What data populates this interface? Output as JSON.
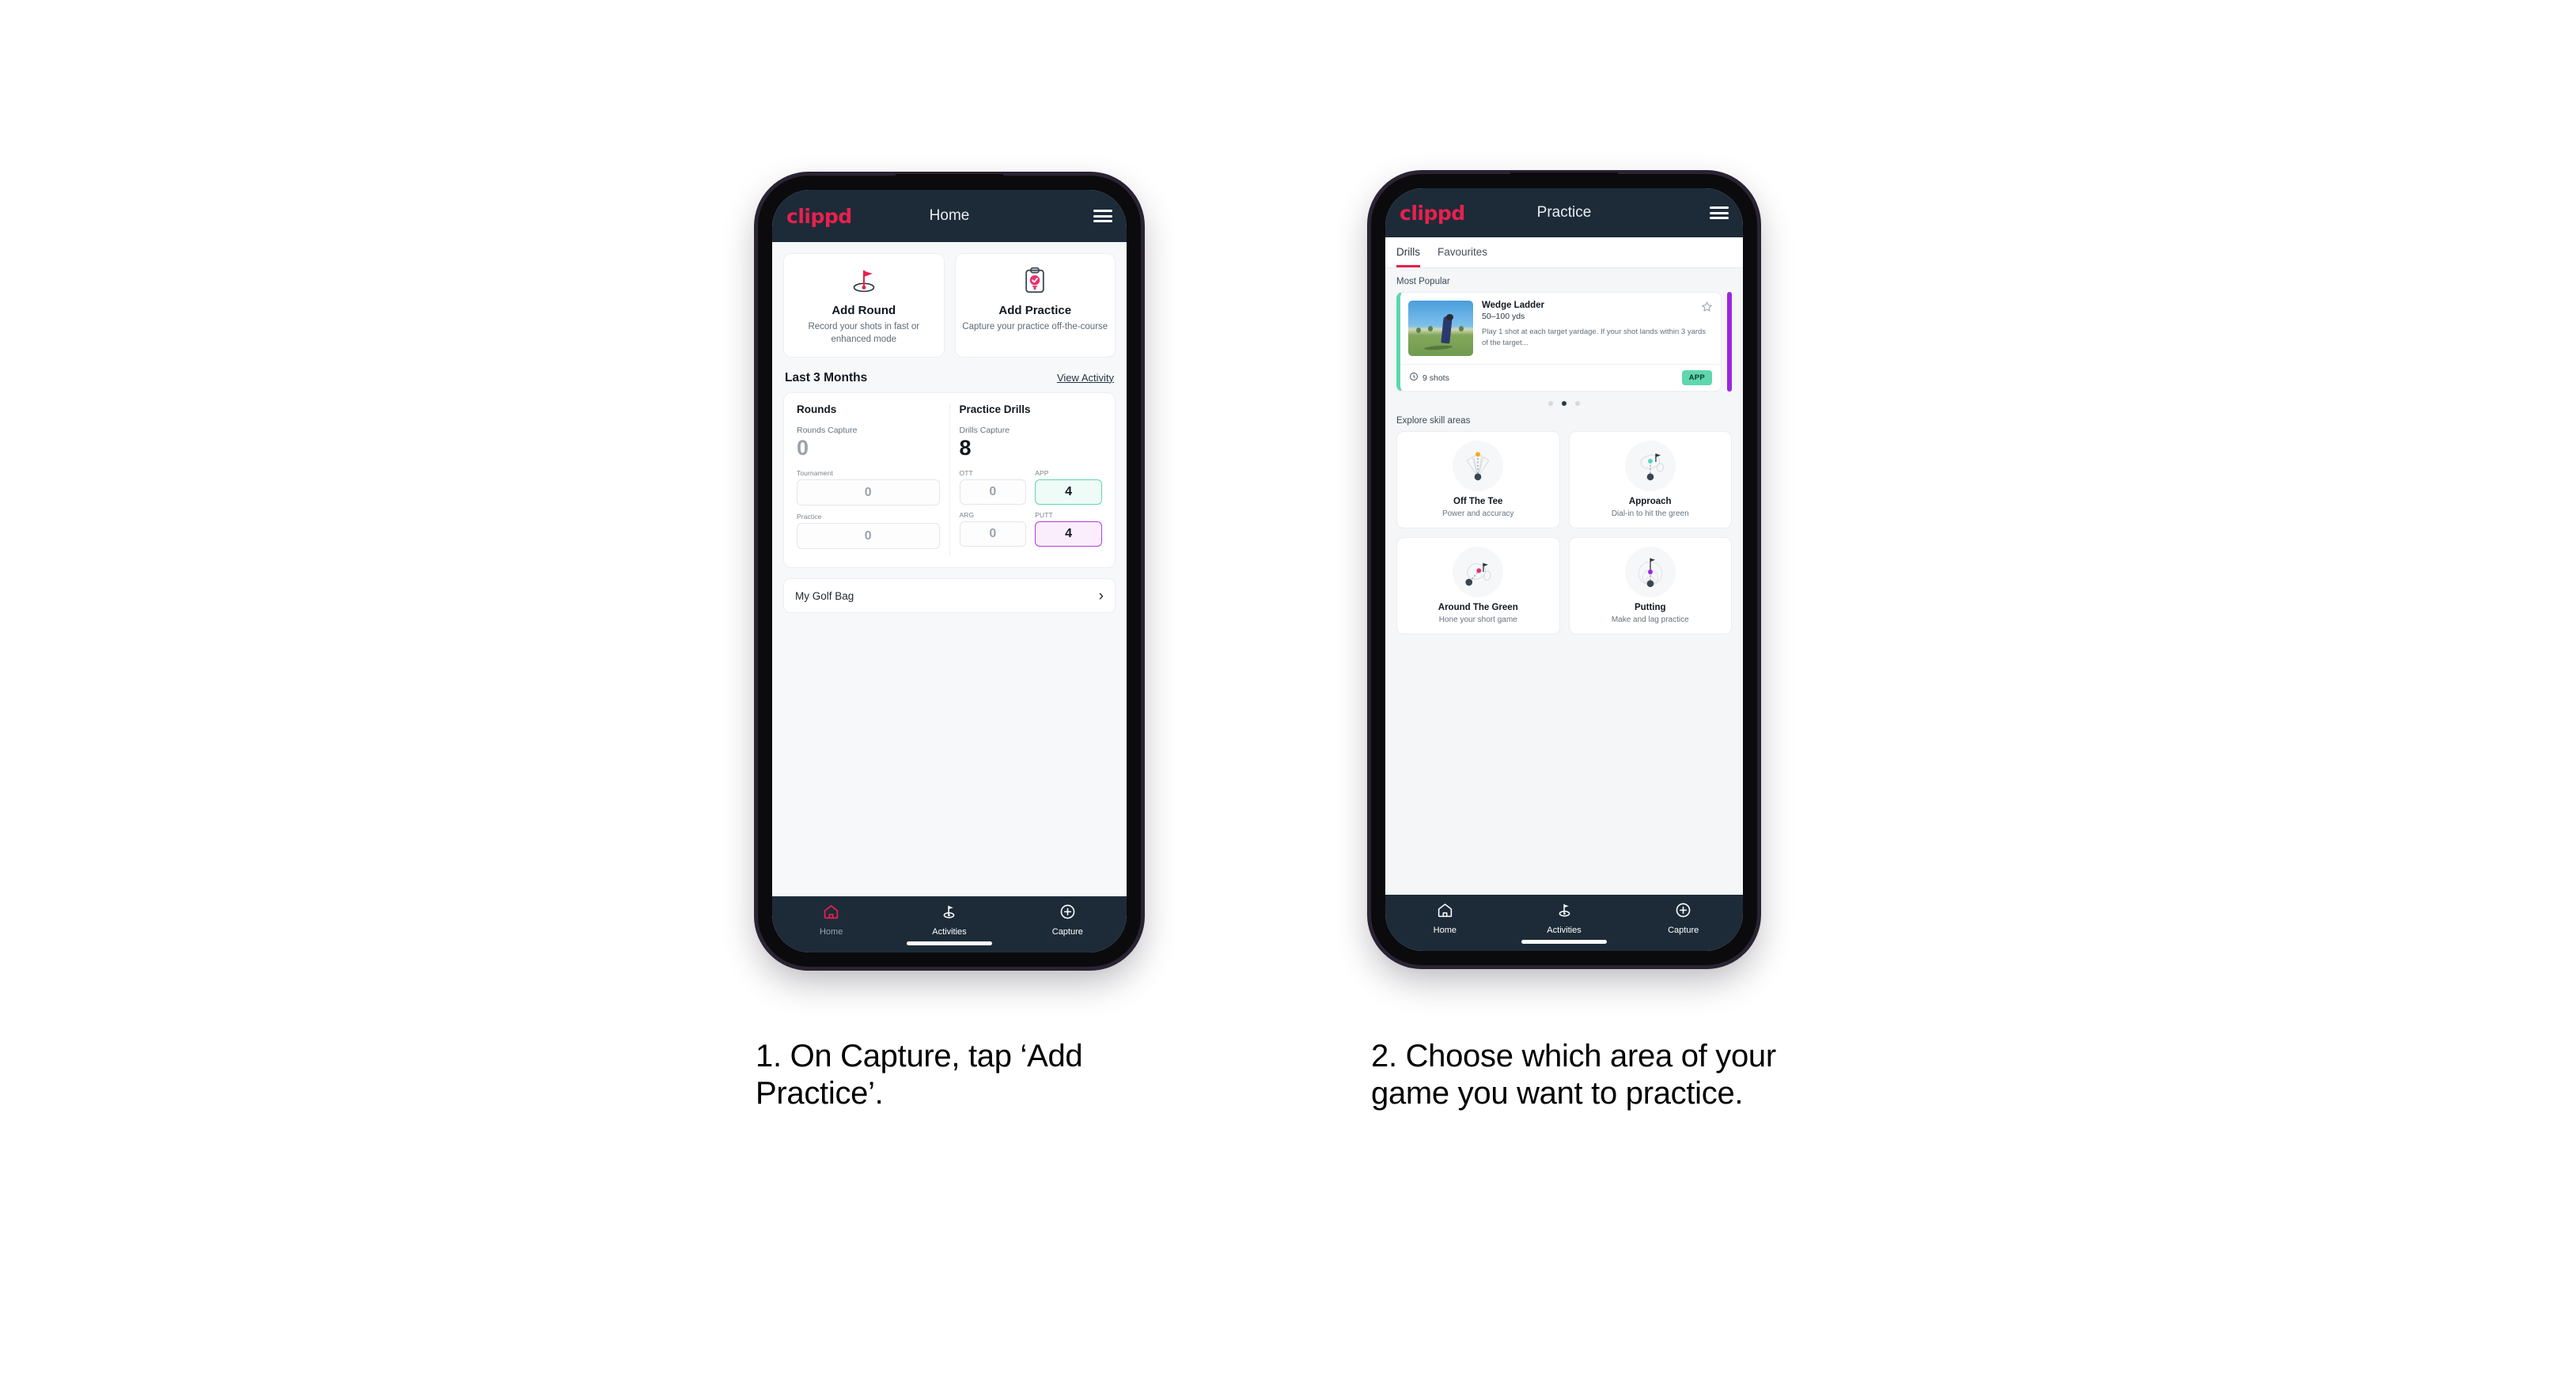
{
  "phone1": {
    "header": {
      "brand": "clippd",
      "title": "Home",
      "menu_icon": "hamburger-icon"
    },
    "actions": [
      {
        "icon": "golf-flag-hole-icon",
        "title": "Add Round",
        "subtitle": "Record your shots in fast or enhanced mode"
      },
      {
        "icon": "clipboard-check-tee-icon",
        "title": "Add Practice",
        "subtitle": "Capture your practice off-the-course"
      }
    ],
    "section": {
      "title": "Last 3 Months",
      "link": "View Activity"
    },
    "rounds": {
      "heading": "Rounds",
      "capture_label": "Rounds Capture",
      "capture_value": "0",
      "items": [
        {
          "label": "Tournament",
          "value": "0",
          "state": "empty"
        },
        {
          "label": "Practice",
          "value": "0",
          "state": "empty"
        }
      ]
    },
    "drills": {
      "heading": "Practice Drills",
      "capture_label": "Drills Capture",
      "capture_value": "8",
      "items": [
        {
          "label": "OTT",
          "value": "0",
          "state": "empty"
        },
        {
          "label": "APP",
          "value": "4",
          "state": "app"
        },
        {
          "label": "ARG",
          "value": "0",
          "state": "empty"
        },
        {
          "label": "PUTT",
          "value": "4",
          "state": "putt"
        }
      ]
    },
    "golf_bag": {
      "label": "My Golf Bag",
      "chevron": "chevron-right-icon"
    },
    "nav": [
      {
        "icon": "home-icon",
        "label": "Home",
        "active": true
      },
      {
        "icon": "golf-flag-icon",
        "label": "Activities",
        "active": false
      },
      {
        "icon": "plus-circle-icon",
        "label": "Capture",
        "active": false
      }
    ]
  },
  "phone2": {
    "header": {
      "brand": "clippd",
      "title": "Practice",
      "menu_icon": "hamburger-icon"
    },
    "tabs": [
      {
        "label": "Drills",
        "active": true
      },
      {
        "label": "Favourites",
        "active": false
      }
    ],
    "most_popular_label": "Most Popular",
    "drill": {
      "title": "Wedge Ladder",
      "yardage": "50–100 yds",
      "description": "Play 1 shot at each target yardage. If your shot lands within 3 yards of the target...",
      "shots": "9 shots",
      "badge": "APP",
      "star_icon": "star-outline-icon",
      "clock_icon": "clock-icon"
    },
    "carousel_dots": [
      {
        "active": false
      },
      {
        "active": true
      },
      {
        "active": false
      }
    ],
    "skill_section_label": "Explore skill areas",
    "skills": [
      {
        "icon": "off-the-tee-icon",
        "name": "Off The Tee",
        "subtitle": "Power and accuracy"
      },
      {
        "icon": "approach-icon",
        "name": "Approach",
        "subtitle": "Dial-in to hit the green"
      },
      {
        "icon": "around-the-green-icon",
        "name": "Around The Green",
        "subtitle": "Hone your short game"
      },
      {
        "icon": "putting-icon",
        "name": "Putting",
        "subtitle": "Make and lag practice"
      }
    ],
    "nav": [
      {
        "icon": "home-icon",
        "label": "Home",
        "active": false
      },
      {
        "icon": "golf-flag-icon",
        "label": "Activities",
        "active": false
      },
      {
        "icon": "plus-circle-icon",
        "label": "Capture",
        "active": false
      }
    ]
  },
  "captions": {
    "step1": "1. On Capture, tap ‘Add Practice’.",
    "step2": "2. Choose which area of your game you want to practice."
  },
  "colors": {
    "brand_pink": "#e8204e",
    "header_dark": "#1d2b38",
    "app_green": "#5fd6ae",
    "putt_purple": "#b23ce0",
    "peek_purple": "#9c27e0"
  }
}
